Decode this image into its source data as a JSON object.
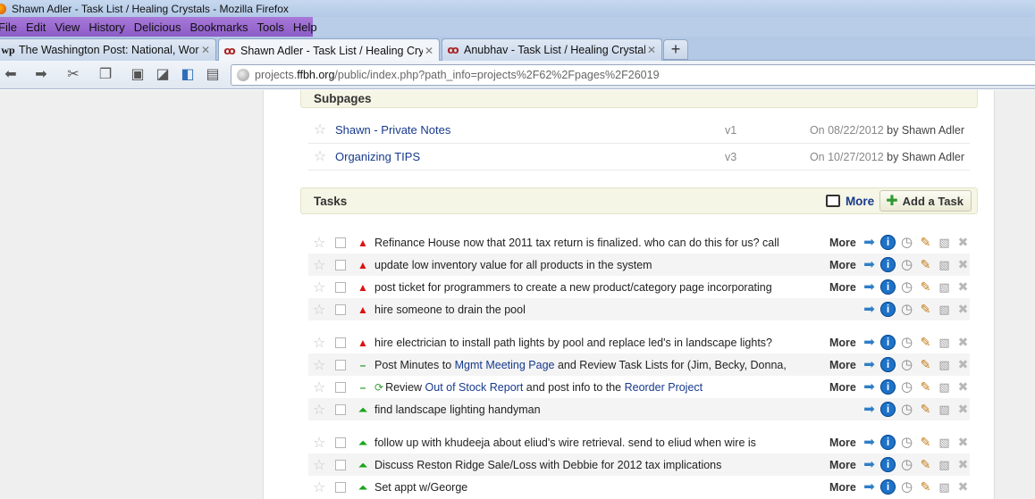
{
  "window": {
    "title": "Shawn Adler - Task List / Healing Crystals - Mozilla Firefox"
  },
  "menu": [
    "File",
    "Edit",
    "View",
    "History",
    "Delicious",
    "Bookmarks",
    "Tools",
    "Help"
  ],
  "tabs": [
    {
      "label": "The Washington Post: National, Worl...",
      "favicon": "wp"
    },
    {
      "label": "Shawn Adler - Task List / Healing Cry...",
      "favicon": "oc"
    },
    {
      "label": "Anubhav - Task List / Healing Crystals",
      "favicon": "oc"
    }
  ],
  "newtab": "+",
  "url": {
    "prefix": "projects.",
    "host": "ffbh.org",
    "path": "/public/index.php?path_info=projects%2F62%2Fpages%2F26019"
  },
  "subpages": {
    "heading": "Subpages",
    "items": [
      {
        "title": "Shawn - Private Notes",
        "version": "v1",
        "date": "On 08/22/2012",
        "by": "by Shawn Adler"
      },
      {
        "title": "Organizing TIPS",
        "version": "v3",
        "date": "On 10/27/2012",
        "by": "by Shawn Adler"
      }
    ]
  },
  "tasks": {
    "heading": "Tasks",
    "more_label": "More",
    "add_label": "Add a Task",
    "items": [
      {
        "text": "Refinance House now that 2011 tax return is finalized.   who can do this for us?  call",
        "priority": "high",
        "more": "More"
      },
      {
        "text": "update low inventory value for all products in the system",
        "priority": "high",
        "more": "More"
      },
      {
        "text": "post ticket for programmers to create a new product/category page incorporating",
        "priority": "high",
        "more": "More"
      },
      {
        "text": "hire someone to drain the pool",
        "priority": "high",
        "more": ""
      },
      {
        "text": "hire electrician to install path lights by pool and replace led's in landscape lights?",
        "priority": "high",
        "more": "More"
      },
      {
        "text_pre": "Post Minutes to ",
        "link1": "Mgmt Meeting Page",
        "text_post": " and Review Task Lists for (Jim, Becky, Donna,",
        "priority": "normal",
        "more": "More"
      },
      {
        "text_pre": "Review ",
        "link1": "Out of Stock Report",
        "text_mid": " and post info to the ",
        "link2": "Reorder Project",
        "priority": "normal",
        "more": "More"
      },
      {
        "text": "find landscape lighting handyman",
        "priority": "low",
        "more": ""
      },
      {
        "text": "follow up with khudeeja about eliud's wire retrieval.  send to eliud when wire is",
        "priority": "low",
        "more": "More"
      },
      {
        "text": "Discuss Reston Ridge Sale/Loss with Debbie for 2012 tax implications",
        "priority": "low",
        "more": "More"
      },
      {
        "text": "Set appt w/George",
        "priority": "low",
        "more": "More"
      }
    ]
  }
}
